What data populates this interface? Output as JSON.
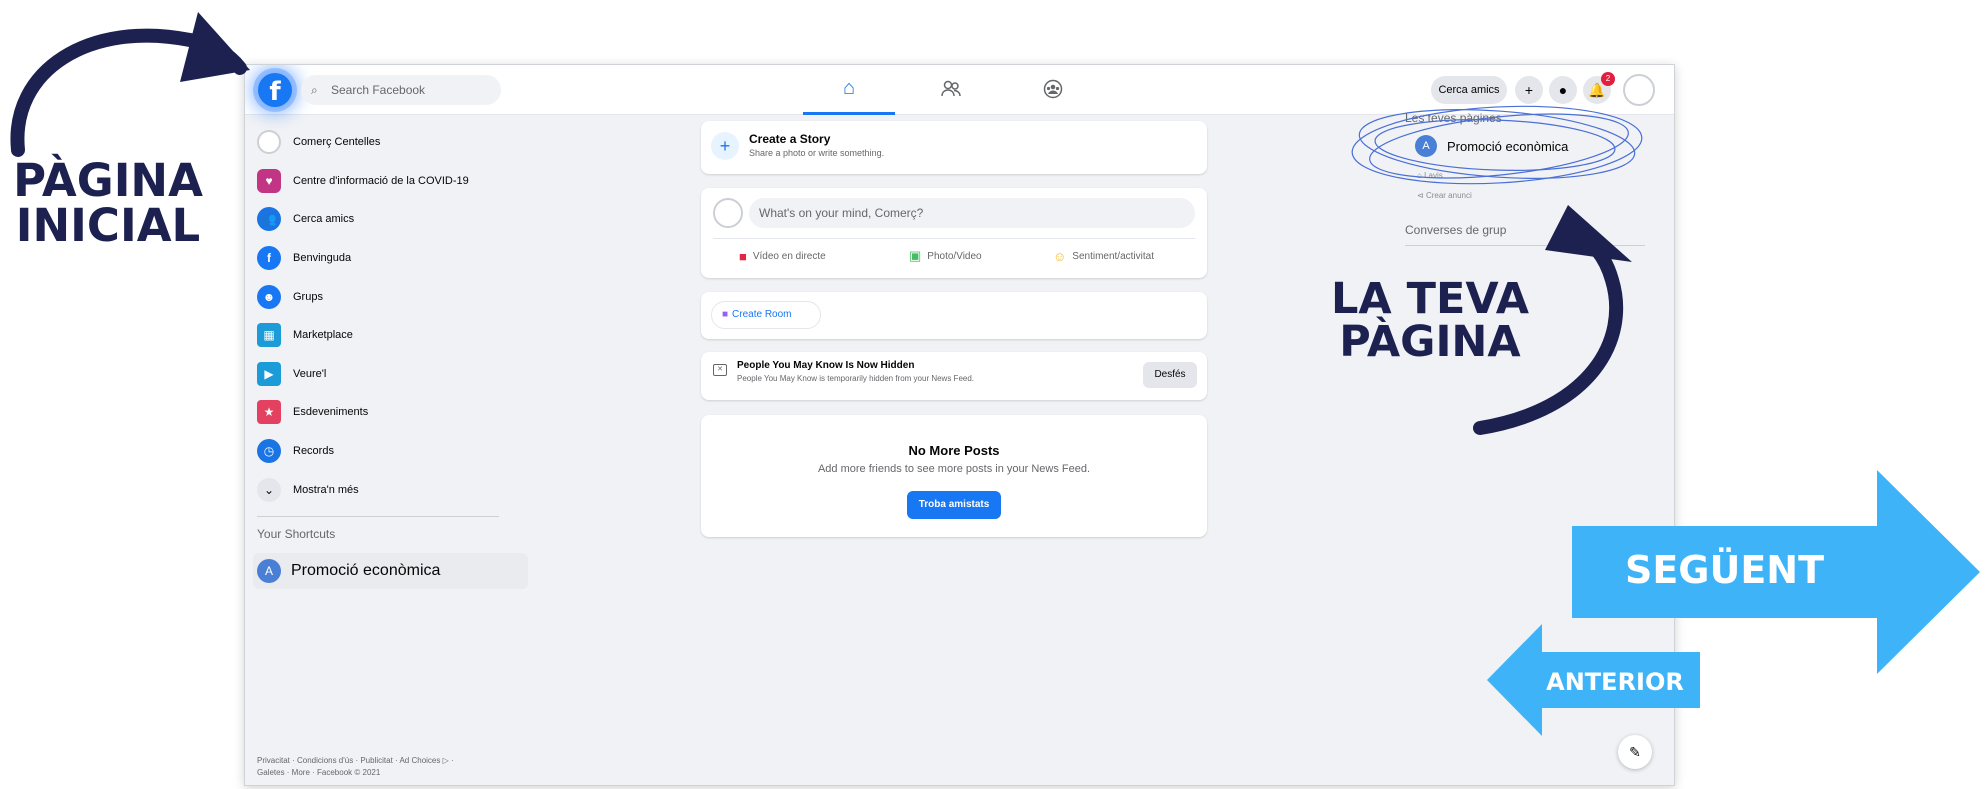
{
  "topbar": {
    "search_placeholder": "Search Facebook",
    "find_friends_label": "Cerca amics",
    "notification_count": "2"
  },
  "sidebar": {
    "items": [
      {
        "label": "Comerç Centelles",
        "icon": "profile-avatar"
      },
      {
        "label": "Centre d'informació de la COVID-19",
        "icon": "covid-shield-icon"
      },
      {
        "label": "Cerca amics",
        "icon": "friends-icon"
      },
      {
        "label": "Benvinguda",
        "icon": "facebook-icon"
      },
      {
        "label": "Grups",
        "icon": "groups-icon"
      },
      {
        "label": "Marketplace",
        "icon": "marketplace-icon"
      },
      {
        "label": "Veure'l",
        "icon": "watch-icon"
      },
      {
        "label": "Esdeveniments",
        "icon": "events-icon"
      },
      {
        "label": "Records",
        "icon": "memories-icon"
      },
      {
        "label": "Mostra'n més",
        "icon": "chevron-down-icon"
      }
    ],
    "shortcuts_title": "Your Shortcuts",
    "shortcut": {
      "initial": "A",
      "label": "Promoció econòmica"
    },
    "footer_line1": "Privacitat · Condicions d'ús · Publicitat · Ad Choices ▷ ·",
    "footer_line2": "Galetes · More · Facebook © 2021"
  },
  "feed": {
    "story_title": "Create a Story",
    "story_sub": "Share a photo or write something.",
    "composer_placeholder": "What's on your mind, Comerç?",
    "action_live": "Vídeo en directe",
    "action_photo": "Photo/Video",
    "action_feeling": "Sentiment/activitat",
    "room_label": "Create Room",
    "hidden_title": "People You May Know Is Now Hidden",
    "hidden_sub": "People You May Know is temporarily hidden from your News Feed.",
    "undo_label": "Desfés",
    "nomore_title": "No More Posts",
    "nomore_sub": "Add more friends to see more posts in your News Feed.",
    "find_friends_button": "Troba amistats"
  },
  "right": {
    "pages_title": "Les teves pàgines",
    "page_initial": "A",
    "page_name": "Promoció econòmica",
    "small_1": "Lavis",
    "small_2": "Crear anunci",
    "group_convos_title": "Converses de grup"
  },
  "annotations": {
    "home_label_line1": "PÀGINA",
    "home_label_line2": "INICIAL",
    "page_label_line1": "LA TEVA",
    "page_label_line2": "PÀGINA",
    "next_label": "SEGÜENT",
    "prev_label": "ANTERIOR"
  },
  "colors": {
    "brand_blue": "#1877f2",
    "annotation_navy": "#1c2150",
    "nav_arrow_blue": "#3eb3f7"
  }
}
